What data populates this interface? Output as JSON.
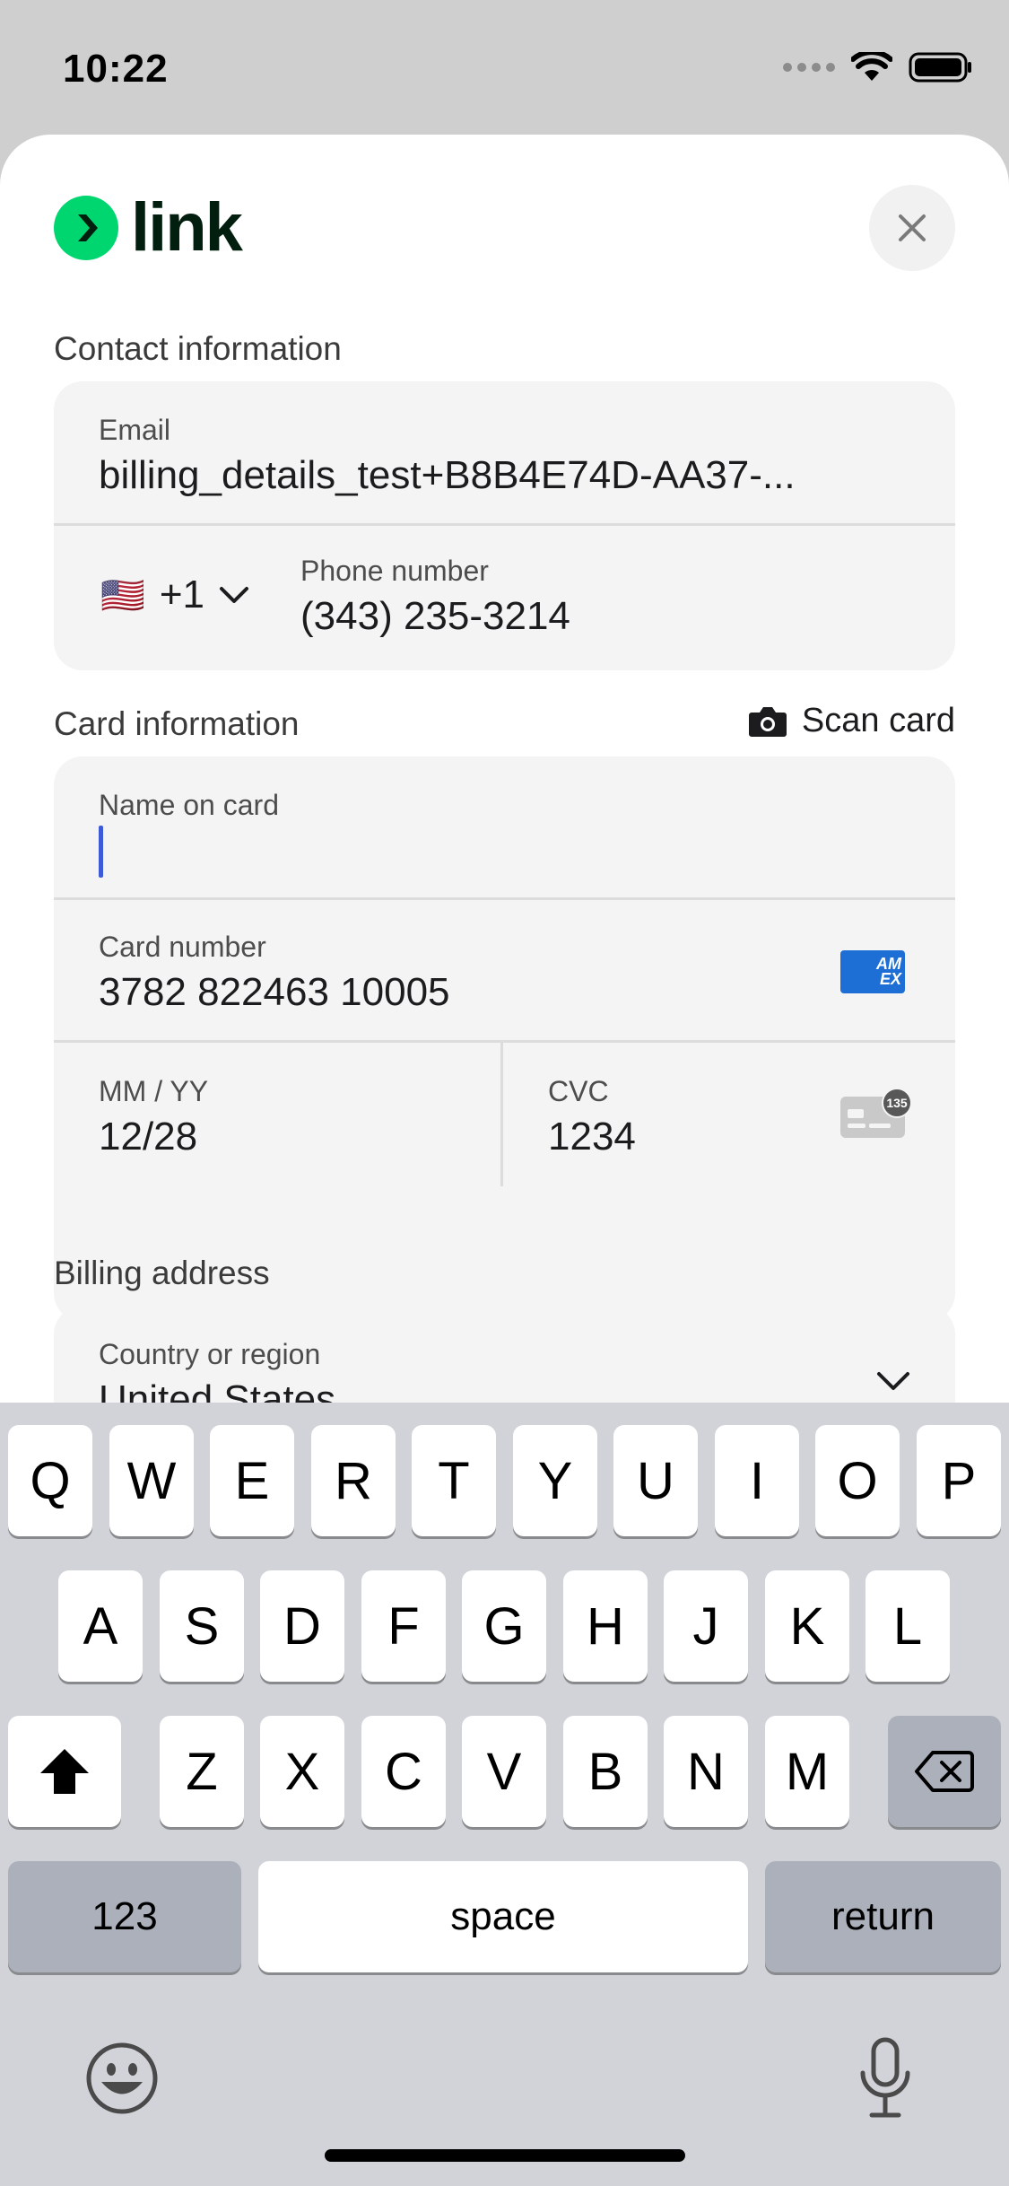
{
  "status_bar": {
    "time": "10:22"
  },
  "brand": {
    "name": "link",
    "accent": "#00d66f"
  },
  "contact": {
    "title": "Contact information",
    "email_label": "Email",
    "email_value": "billing_details_test+B8B4E74D-AA37-...",
    "phone_country_flag": "🇺🇸",
    "phone_country_code": "+1",
    "phone_label": "Phone number",
    "phone_value": "(343) 235-3214"
  },
  "card": {
    "title": "Card information",
    "scan_label": "Scan card",
    "name_label": "Name on card",
    "name_value": "",
    "number_label": "Card number",
    "number_value": "3782 822463 10005",
    "brand_badge_line1": "AM",
    "brand_badge_line2": "EX",
    "expiry_label": "MM / YY",
    "expiry_value": "12/28",
    "cvc_label": "CVC",
    "cvc_value": "1234",
    "cvc_badge": "135"
  },
  "billing": {
    "title": "Billing address",
    "country_label": "Country or region",
    "country_value": "United States"
  },
  "keyboard": {
    "row1": [
      "Q",
      "W",
      "E",
      "R",
      "T",
      "Y",
      "U",
      "I",
      "O",
      "P"
    ],
    "row2": [
      "A",
      "S",
      "D",
      "F",
      "G",
      "H",
      "J",
      "K",
      "L"
    ],
    "row3": [
      "Z",
      "X",
      "C",
      "V",
      "B",
      "N",
      "M"
    ],
    "numbers_label": "123",
    "space_label": "space",
    "return_label": "return"
  }
}
